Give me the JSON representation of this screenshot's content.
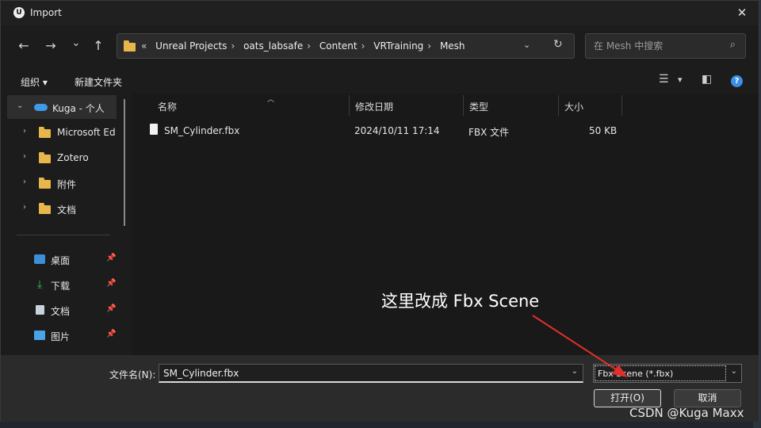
{
  "window": {
    "title": "Import",
    "close_glyph": "✕"
  },
  "nav": {
    "back_glyph": "←",
    "forward_glyph": "→",
    "history_glyph": "⌄",
    "up_glyph": "↑",
    "overflow": "«",
    "breadcrumb": [
      "Unreal Projects",
      "oats_labsafe",
      "Content",
      "VRTraining",
      "Mesh"
    ],
    "sep": "›",
    "dropdown_glyph": "⌄",
    "refresh_glyph": "↻",
    "search_placeholder": "在 Mesh 中搜索",
    "search_glyph": "⌕"
  },
  "toolbar": {
    "organize": "组织 ▾",
    "new_folder": "新建文件夹",
    "view_glyph": "☰",
    "view_dd": "▾",
    "pane_glyph": "◧",
    "help_glyph": "?"
  },
  "sidebar": {
    "onedrive": {
      "label": "Kuga - 个人",
      "chev": "⌄"
    },
    "folders": [
      {
        "label": "Microsoft Ed",
        "chev": "›"
      },
      {
        "label": "Zotero",
        "chev": "›"
      },
      {
        "label": "附件",
        "chev": "›"
      },
      {
        "label": "文档",
        "chev": "›"
      }
    ],
    "quick": [
      {
        "label": "桌面",
        "pin": "📌"
      },
      {
        "label": "下载",
        "pin": "📌"
      },
      {
        "label": "文档",
        "pin": "📌"
      },
      {
        "label": "图片",
        "pin": "📌"
      }
    ]
  },
  "columns": {
    "name": "名称",
    "date": "修改日期",
    "type": "类型",
    "size": "大小",
    "sort_glyph": "︿"
  },
  "files": [
    {
      "name": "SM_Cylinder.fbx",
      "date": "2024/10/11 17:14",
      "type": "FBX 文件",
      "size": "50 KB"
    }
  ],
  "footer": {
    "filename_label": "文件名(N):",
    "filename_value": "SM_Cylinder.fbx",
    "filename_dd": "⌄",
    "filetype": "Fbx Scene (*.fbx)",
    "filetype_dd": "⌄",
    "open": "打开(O)",
    "cancel": "取消"
  },
  "annotation": {
    "text": "这里改成 Fbx Scene",
    "arrow_color": "#e0302a"
  },
  "watermark": "CSDN @Kuga Maxx"
}
